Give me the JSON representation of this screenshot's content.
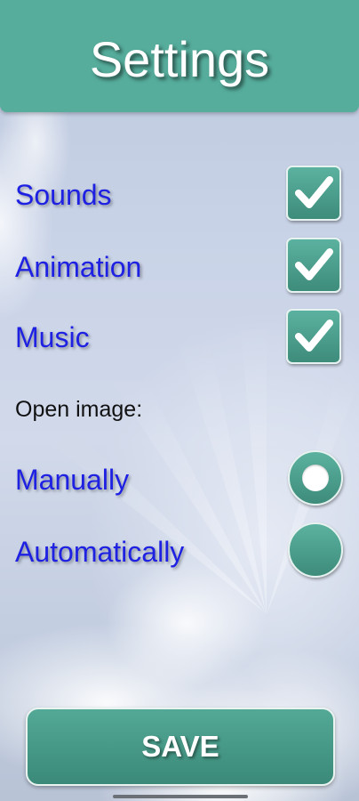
{
  "header": {
    "title": "Settings"
  },
  "options": [
    {
      "label": "Sounds",
      "checked": true
    },
    {
      "label": "Animation",
      "checked": true
    },
    {
      "label": "Music",
      "checked": true
    }
  ],
  "open_image": {
    "label": "Open image:",
    "choices": [
      {
        "label": "Manually",
        "selected": true
      },
      {
        "label": "Automatically",
        "selected": false
      }
    ]
  },
  "save_label": "SAVE",
  "colors": {
    "accent": "#56ad9c",
    "label_text": "#1e20e2",
    "section_text": "#111111"
  },
  "icons": {
    "checkbox_mark": "checkmark-icon",
    "radio_selected": "radio-dot-icon"
  }
}
